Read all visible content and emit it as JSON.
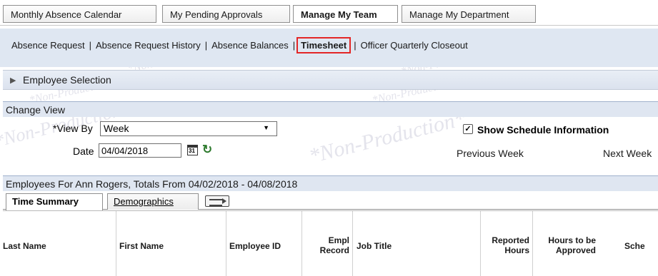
{
  "top_tabs": [
    {
      "label": "Monthly Absence Calendar"
    },
    {
      "label": "My Pending Approvals"
    },
    {
      "label": "Manage My Team"
    },
    {
      "label": "Manage My Department"
    }
  ],
  "sub_links": {
    "absence_request": "Absence Request",
    "absence_request_history": "Absence Request History",
    "absence_balances": "Absence Balances",
    "timesheet": "Timesheet",
    "officer_quarterly_closeout": "Officer Quarterly Closeout",
    "separator": "|"
  },
  "employee_selection": {
    "label": "Employee Selection"
  },
  "change_view": {
    "label": "Change View",
    "view_by_label": "*View By",
    "view_by_value": "Week",
    "date_label": "Date",
    "date_value": "04/04/2018",
    "show_schedule_label": "Show Schedule Information",
    "show_schedule_checked": true,
    "previous_week": "Previous Week",
    "next_week": "Next Week"
  },
  "employees": {
    "header": "Employees For Ann Rogers, Totals From 04/02/2018 - 04/08/2018",
    "tabs": [
      {
        "label": "Time Summary"
      },
      {
        "label": "Demographics"
      }
    ],
    "columns": {
      "last_name": "Last Name",
      "first_name": "First Name",
      "employee_id": "Employee ID",
      "empl_record_1": "Empl",
      "empl_record_2": "Record",
      "job_title": "Job Title",
      "reported_1": "Reported",
      "reported_2": "Hours",
      "to_approve_1": "Hours to be",
      "to_approve_2": "Approved",
      "schedule": "Sche"
    }
  },
  "watermark": "*Non-Production*",
  "colors": {
    "highlight": "#e32626",
    "bar": "#dfe7f2",
    "section_header": "#dfe6f1"
  },
  "icons": [
    "triangle-right-icon",
    "calendar-icon",
    "refresh-icon",
    "grid-view-icon",
    "checkbox-checked-icon"
  ]
}
